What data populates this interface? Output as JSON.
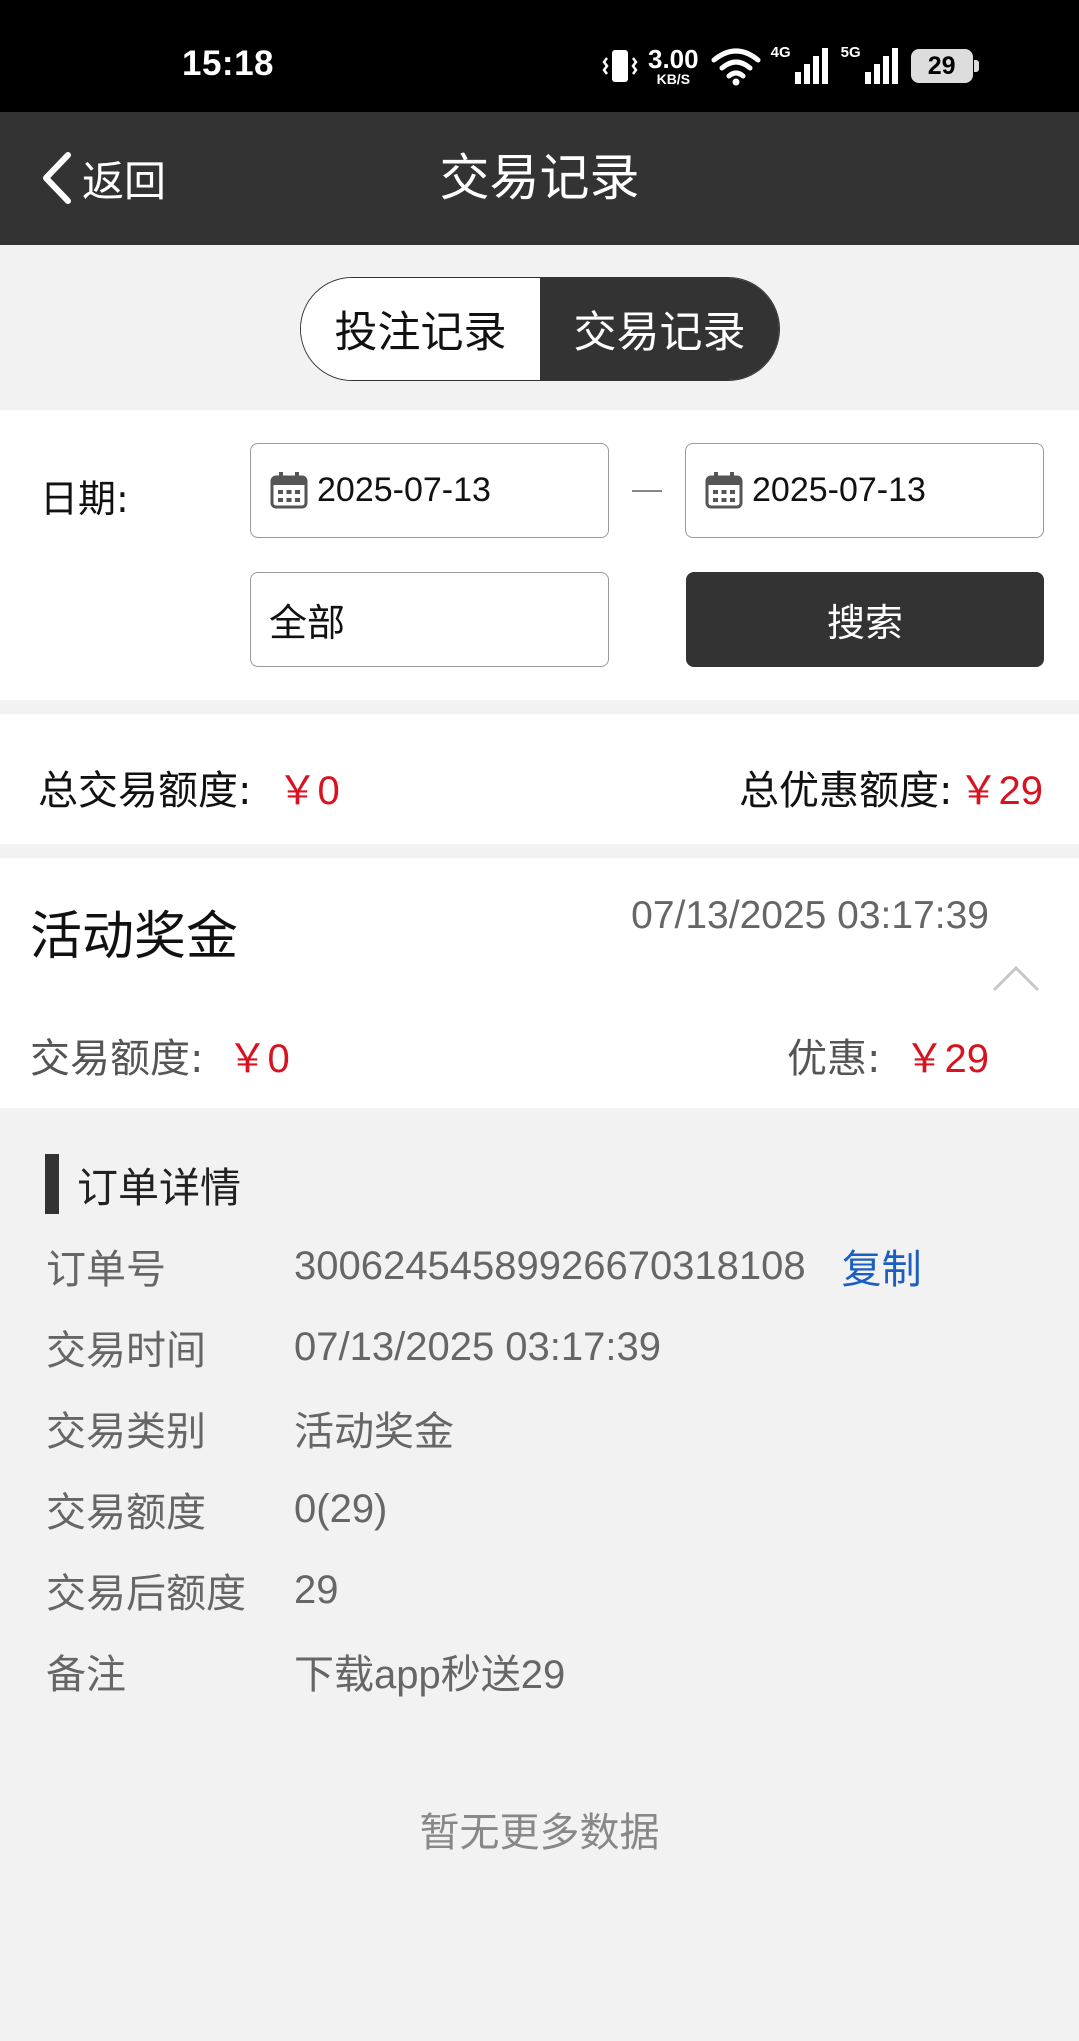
{
  "status_bar": {
    "time": "15:18",
    "net_speed": "3.00",
    "net_speed_unit": "KB/S",
    "network_4g": "4G",
    "network_5g": "5G",
    "battery": "29"
  },
  "nav": {
    "back_label": "返回",
    "title": "交易记录"
  },
  "tabs": [
    {
      "label": "投注记录",
      "active": false
    },
    {
      "label": "交易记录",
      "active": true
    }
  ],
  "filter": {
    "date_label": "日期:",
    "start_date": "2025-07-13",
    "end_date": "2025-07-13",
    "type_selected": "全部",
    "search_label": "搜索"
  },
  "totals": {
    "total_amount_label": "总交易额度:",
    "total_amount_value": "￥0",
    "total_bonus_label": "总优惠额度:",
    "total_bonus_value": "￥29"
  },
  "record": {
    "title": "活动奖金",
    "time": "07/13/2025 03:17:39",
    "amount_label": "交易额度:",
    "amount_value": "￥0",
    "bonus_label": "优惠:",
    "bonus_value": "￥29"
  },
  "detail": {
    "heading": "订单详情",
    "copy_label": "复制",
    "rows": [
      {
        "key": "订单号",
        "value": "30062454589926670318108"
      },
      {
        "key": "交易时间",
        "value": "07/13/2025 03:17:39"
      },
      {
        "key": "交易类别",
        "value": "活动奖金"
      },
      {
        "key": "交易额度",
        "value": "0(29)"
      },
      {
        "key": "交易后额度",
        "value": "29"
      },
      {
        "key": "备注",
        "value": "下载app秒送29"
      }
    ]
  },
  "footer": {
    "no_more": "暂无更多数据"
  },
  "colors": {
    "header_bg": "#333333",
    "accent_red": "#d8121e",
    "link_blue": "#1a5fc0",
    "page_bg": "#f2f2f2"
  }
}
